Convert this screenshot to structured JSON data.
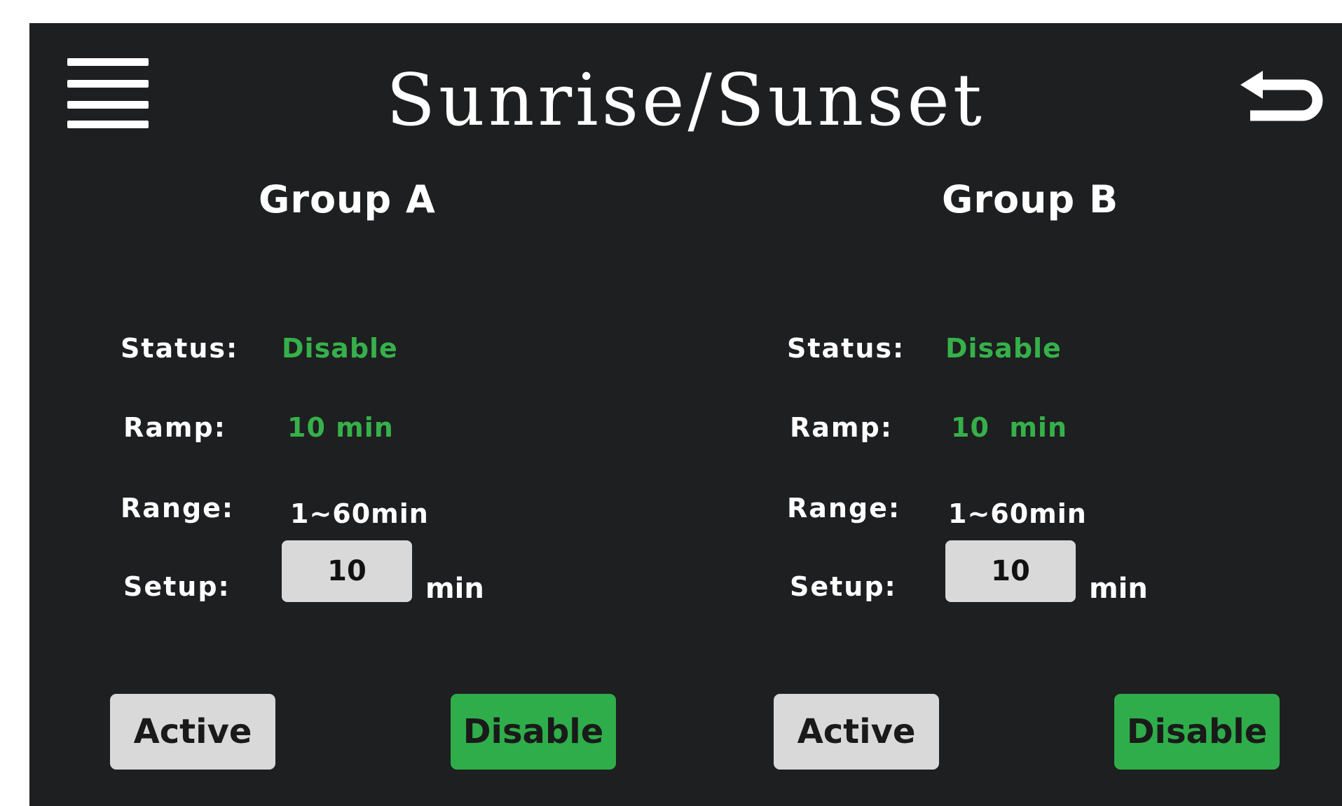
{
  "header": {
    "title": "Sunrise/Sunset",
    "menu_icon": "hamburger-menu-icon",
    "back_icon": "return-arrow-icon"
  },
  "colors": {
    "background": "#1d1f20",
    "accent_green": "#2fad4a",
    "status_text_green": "#36b04a",
    "button_gray": "#d9d9d9"
  },
  "groups": [
    {
      "title": "Group A",
      "status_label": "Status:",
      "status_value": "Disable",
      "ramp_label": "Ramp:",
      "ramp_value": "10 min",
      "range_label": "Range:",
      "range_value": "1~60min",
      "setup_label": "Setup:",
      "setup_value": "10",
      "setup_unit": "min",
      "active_button": "Active",
      "disable_button": "Disable"
    },
    {
      "title": "Group B",
      "status_label": "Status:",
      "status_value": "Disable",
      "ramp_label": "Ramp:",
      "ramp_value": "10  min",
      "range_label": "Range:",
      "range_value": "1~60min",
      "setup_label": "Setup:",
      "setup_value": "10",
      "setup_unit": "min",
      "active_button": "Active",
      "disable_button": "Disable"
    }
  ]
}
